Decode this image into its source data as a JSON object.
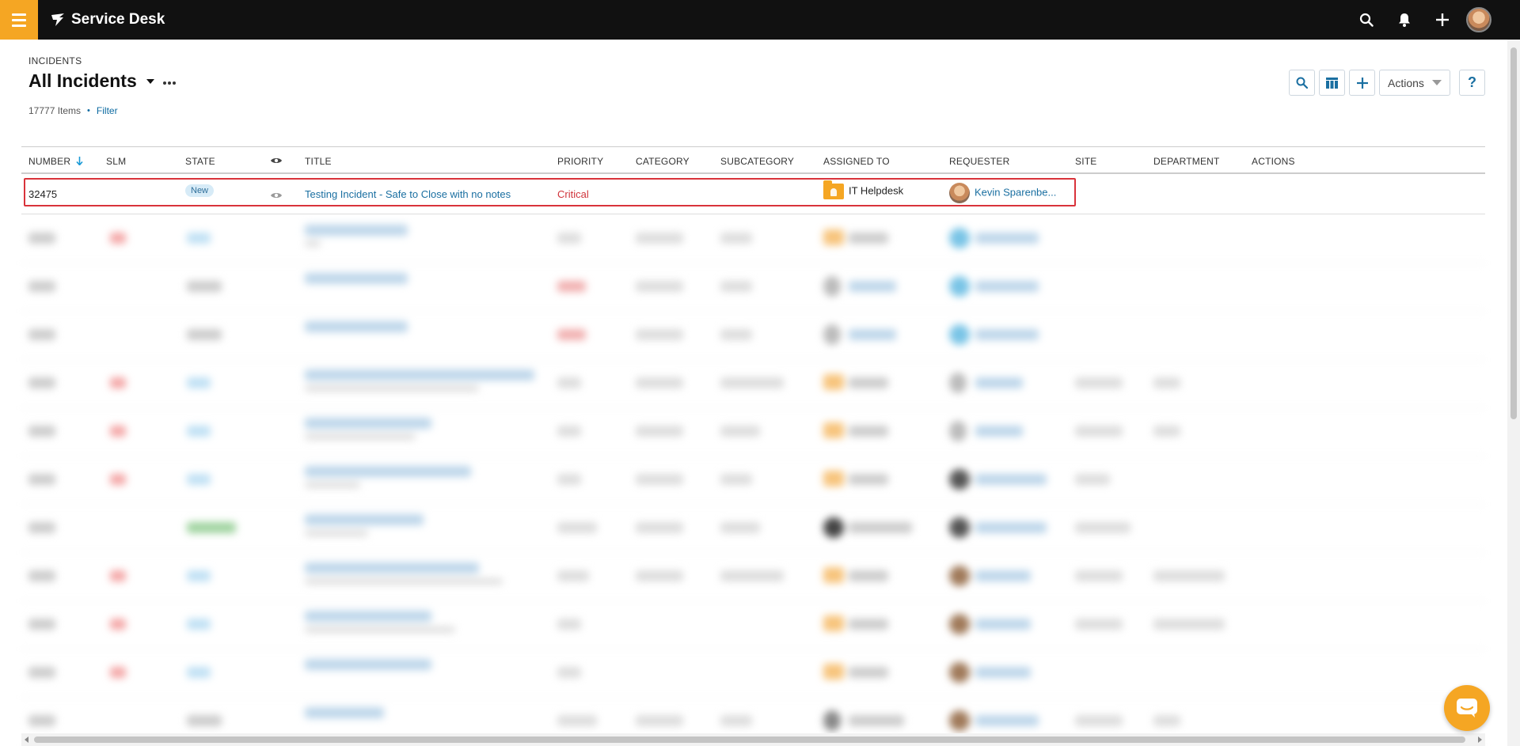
{
  "app": {
    "brand": "Service Desk"
  },
  "header": {
    "breadcrumb": "INCIDENTS",
    "title": "All Incidents",
    "item_count": "17777 Items",
    "filter_label": "Filter"
  },
  "toolbar": {
    "actions_label": "Actions",
    "help_label": "?"
  },
  "table": {
    "columns": [
      "NUMBER",
      "SLM",
      "STATE",
      "TITLE",
      "PRIORITY",
      "CATEGORY",
      "SUBCATEGORY",
      "ASSIGNED TO",
      "REQUESTER",
      "SITE",
      "DEPARTMENT",
      "ACTIONS"
    ],
    "highlighted_row": {
      "number": "32475",
      "state": "New",
      "title": "Testing Incident - Safe to Close with no notes",
      "priority": "Critical",
      "assigned_to": "IT Helpdesk",
      "requester": "Kevin Sparenbe..."
    }
  },
  "colors": {
    "accent": "#f5a623",
    "link": "#1a6fa1",
    "critical": "#d0343b",
    "highlight_border": "#d9333b"
  }
}
